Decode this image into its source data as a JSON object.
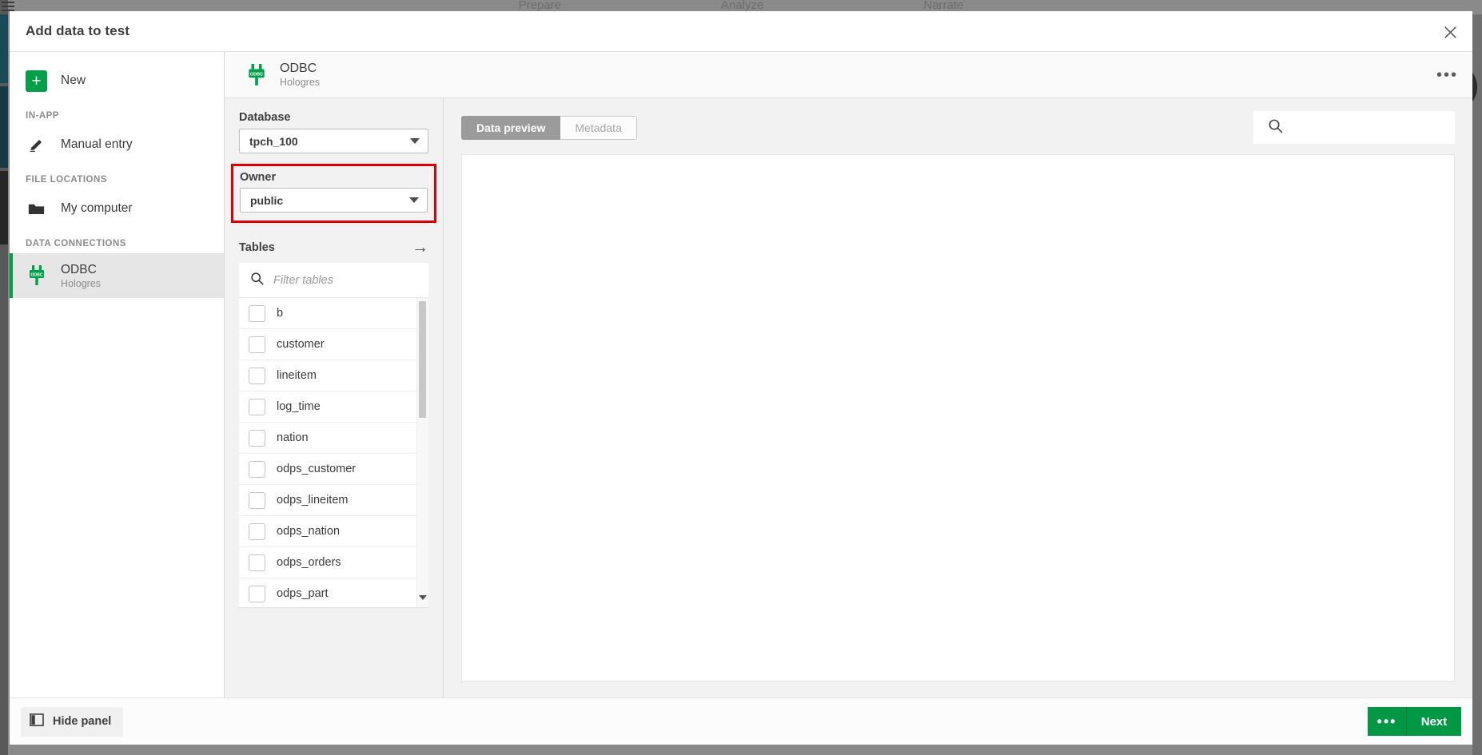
{
  "background": {
    "nav_tabs": [
      "Prepare",
      "Analyze",
      "Narrate"
    ],
    "hamburger_icon": "hamburger-icon"
  },
  "modal": {
    "title": "Add data to test",
    "close_icon": "close-icon"
  },
  "sidebar": {
    "new": {
      "label": "New",
      "icon": "plus-icon"
    },
    "sections": [
      {
        "heading": "IN-APP",
        "items": [
          {
            "label": "Manual entry",
            "icon": "pencil-icon",
            "active": false
          }
        ]
      },
      {
        "heading": "FILE LOCATIONS",
        "items": [
          {
            "label": "My computer",
            "icon": "folder-icon",
            "active": false
          }
        ]
      },
      {
        "heading": "DATA CONNECTIONS",
        "items": [
          {
            "label": "ODBC",
            "sublabel": "Hologres",
            "icon": "odbc-plug-icon",
            "active": true
          }
        ]
      }
    ]
  },
  "connection_header": {
    "name": "ODBC",
    "subtitle": "Hologres",
    "icon": "odbc-plug-icon",
    "overflow_icon": "ellipsis-icon"
  },
  "selector": {
    "database": {
      "label": "Database",
      "value": "tpch_100",
      "caret_icon": "chevron-down-icon"
    },
    "owner": {
      "label": "Owner",
      "value": "public",
      "caret_icon": "chevron-down-icon",
      "highlighted": true
    },
    "tables": {
      "label": "Tables",
      "expand_icon": "arrow-right-icon",
      "filter": {
        "placeholder": "Filter tables",
        "value": "",
        "icon": "search-icon"
      },
      "items": [
        {
          "name": "b",
          "checked": false
        },
        {
          "name": "customer",
          "checked": false
        },
        {
          "name": "lineitem",
          "checked": false
        },
        {
          "name": "log_time",
          "checked": false
        },
        {
          "name": "nation",
          "checked": false
        },
        {
          "name": "odps_customer",
          "checked": false
        },
        {
          "name": "odps_lineitem",
          "checked": false
        },
        {
          "name": "odps_nation",
          "checked": false
        },
        {
          "name": "odps_orders",
          "checked": false
        },
        {
          "name": "odps_part",
          "checked": false
        }
      ],
      "scroll_down_icon": "triangle-down-icon"
    }
  },
  "preview": {
    "tabs": [
      {
        "label": "Data preview",
        "selected": true
      },
      {
        "label": "Metadata",
        "selected": false
      }
    ],
    "search": {
      "placeholder": "",
      "value": "",
      "icon": "search-icon"
    }
  },
  "footer": {
    "hide_panel": {
      "label": "Hide panel",
      "icon": "panel-icon"
    },
    "more": {
      "label": "•••"
    },
    "next": {
      "label": "Next"
    }
  },
  "colors": {
    "brand_green": "#00A04A",
    "next_green": "#009845",
    "highlight_red": "#e00000",
    "tab_active_gray": "#9b9b9b"
  }
}
